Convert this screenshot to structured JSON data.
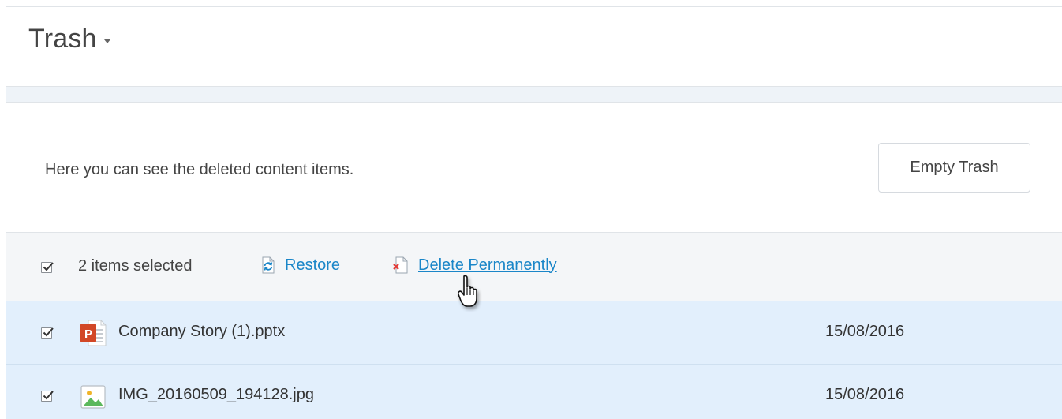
{
  "header": {
    "title": "Trash"
  },
  "info": {
    "description": "Here you can see the deleted content items.",
    "empty_trash_label": "Empty Trash"
  },
  "action_bar": {
    "selected_count": "2 items selected",
    "restore_label": "Restore",
    "delete_label": "Delete Permanently"
  },
  "files": [
    {
      "name": "Company Story (1).pptx",
      "date": "15/08/2016",
      "icon": "powerpoint-file-icon",
      "checked": true
    },
    {
      "name": "IMG_20160509_194128.jpg",
      "date": "15/08/2016",
      "icon": "image-file-icon",
      "checked": true
    }
  ],
  "colors": {
    "link": "#1a86c8",
    "selected_row": "#e2effc",
    "powerpoint": "#d24726",
    "image_green": "#5cb85c"
  }
}
